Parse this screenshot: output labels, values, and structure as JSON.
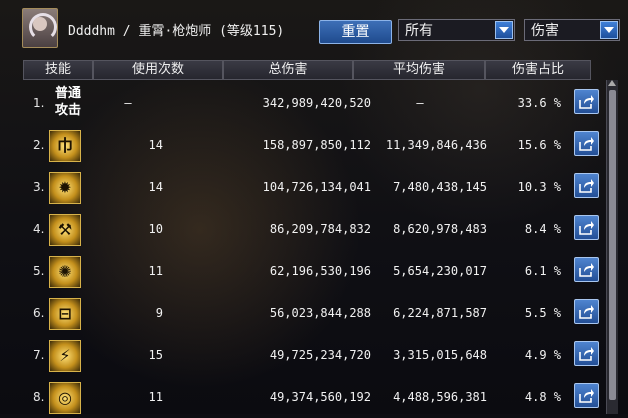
{
  "header": {
    "title": "Ddddhm / 重霄·枪炮师 (等级115)",
    "reset_label": "重置",
    "filter_select": "所有",
    "metric_select": "伤害"
  },
  "table": {
    "columns": [
      "技能",
      "使用次数",
      "总伤害",
      "平均伤害",
      "伤害占比"
    ],
    "rows": [
      {
        "index": "1.",
        "skill": "普通攻击",
        "icon": "basic-attack-text",
        "uses": "–",
        "total": "342,989,420,520",
        "avg": "–",
        "pct": "33.6 %"
      },
      {
        "index": "2.",
        "skill": "",
        "icon": "skill-icon-2",
        "uses": "14",
        "total": "158,897,850,112",
        "avg": "11,349,846,436",
        "pct": "15.6 %"
      },
      {
        "index": "3.",
        "skill": "",
        "icon": "skill-icon-3",
        "uses": "14",
        "total": "104,726,134,041",
        "avg": "7,480,438,145",
        "pct": "10.3 %"
      },
      {
        "index": "4.",
        "skill": "",
        "icon": "skill-icon-4",
        "uses": "10",
        "total": "86,209,784,832",
        "avg": "8,620,978,483",
        "pct": "8.4 %"
      },
      {
        "index": "5.",
        "skill": "",
        "icon": "skill-icon-5",
        "uses": "11",
        "total": "62,196,530,196",
        "avg": "5,654,230,017",
        "pct": "6.1 %"
      },
      {
        "index": "6.",
        "skill": "",
        "icon": "skill-icon-6",
        "uses": "9",
        "total": "56,023,844,288",
        "avg": "6,224,871,587",
        "pct": "5.5 %"
      },
      {
        "index": "7.",
        "skill": "",
        "icon": "skill-icon-7",
        "uses": "15",
        "total": "49,725,234,720",
        "avg": "3,315,015,648",
        "pct": "4.9 %"
      },
      {
        "index": "8.",
        "skill": "",
        "icon": "skill-icon-8",
        "uses": "11",
        "total": "49,374,560,192",
        "avg": "4,488,596,381",
        "pct": "4.8 %"
      }
    ]
  }
}
